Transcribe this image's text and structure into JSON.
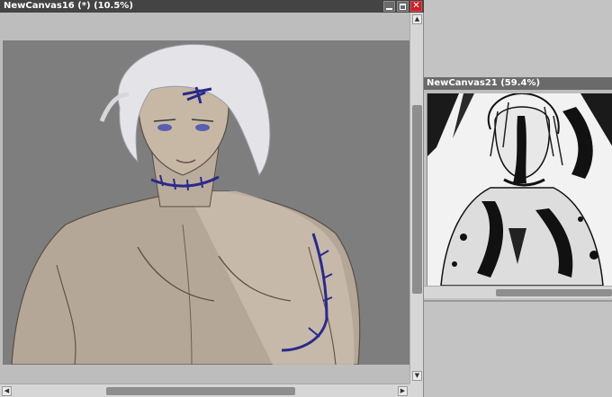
{
  "windows": {
    "canvas_main": {
      "title": "NewCanvas16 (*) (10.5%)",
      "vertical_scroll_fraction": 0.25,
      "horizontal_scroll_fraction": 0.36
    },
    "canvas_ref": {
      "title": "NewCanvas21 (59.4%)",
      "horizontal_scroll_fraction": 0.62
    }
  },
  "controls": {
    "minimize": "minimize-icon",
    "maximize": "maximize-icon",
    "close": "close-icon",
    "scroll_up": "arrow-up-icon",
    "scroll_down": "arrow-down-icon",
    "scroll_left": "arrow-left-icon",
    "scroll_right": "arrow-right-icon"
  },
  "colors": {
    "titlebar_active": "#444444",
    "titlebar_inactive": "#6a6a6a",
    "close_button": "#c8222a",
    "canvas_backdrop": "#7e7e7e",
    "tattoo_ink": "#2a2a8a"
  }
}
